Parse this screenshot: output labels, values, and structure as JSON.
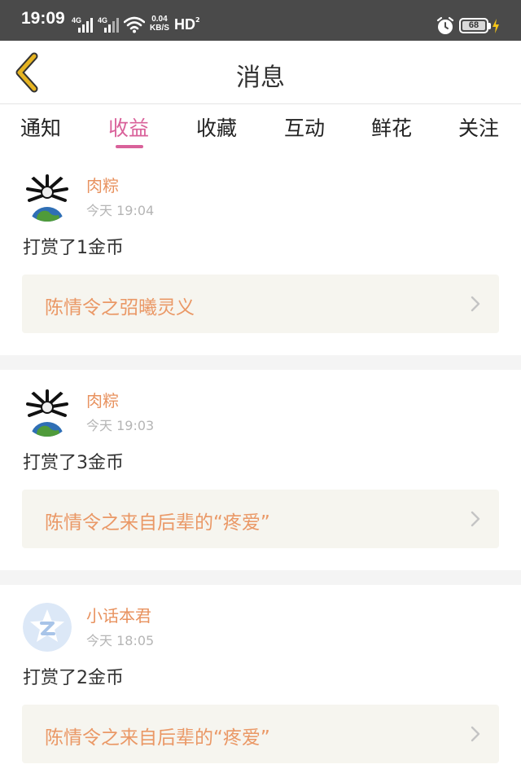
{
  "status_bar": {
    "time": "19:09",
    "network_1": "4G",
    "network_2": "4G",
    "speed_value": "0.04",
    "speed_unit": "KB/S",
    "hd_label": "HD",
    "hd_sub": "2",
    "battery_level": "68"
  },
  "header": {
    "title": "消息",
    "back_icon": "back-chevron-icon"
  },
  "tabs": [
    {
      "label": "通知",
      "active": false
    },
    {
      "label": "收益",
      "active": true
    },
    {
      "label": "收藏",
      "active": false
    },
    {
      "label": "互动",
      "active": false
    },
    {
      "label": "鲜花",
      "active": false
    },
    {
      "label": "关注",
      "active": false
    }
  ],
  "messages": [
    {
      "user": "肉粽",
      "time": "今天 19:04",
      "text": "打赏了1金币",
      "book": "陈情令之弨曦灵义"
    },
    {
      "user": "肉粽",
      "time": "今天 19:03",
      "text": "打赏了3金币",
      "book": "陈情令之来自后辈的“疼爱”"
    },
    {
      "user": "小话本君",
      "time": "今天 18:05",
      "text": "打赏了2金币",
      "book": "陈情令之来自后辈的“疼爱”"
    }
  ],
  "colors": {
    "accent_pink": "#d9619a",
    "orange": "#e8925f",
    "back_yellow": "#e6b422"
  }
}
